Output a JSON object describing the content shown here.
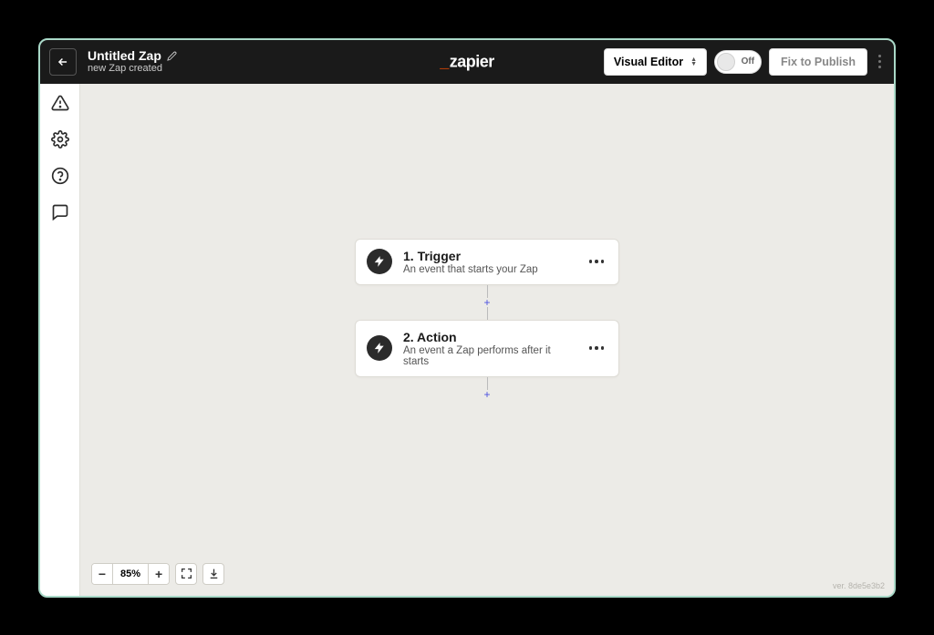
{
  "header": {
    "title": "Untitled Zap",
    "subtitle": "new Zap created",
    "visual_editor_label": "Visual Editor",
    "toggle_label": "Off",
    "publish_label": "Fix to Publish",
    "logo_text": "zapier"
  },
  "steps": [
    {
      "title": "1. Trigger",
      "desc": "An event that starts your Zap"
    },
    {
      "title": "2. Action",
      "desc": "An event a Zap performs after it starts"
    }
  ],
  "zoom": {
    "percent": "85%"
  },
  "footer": {
    "version": "ver. 8de5e3b2"
  }
}
